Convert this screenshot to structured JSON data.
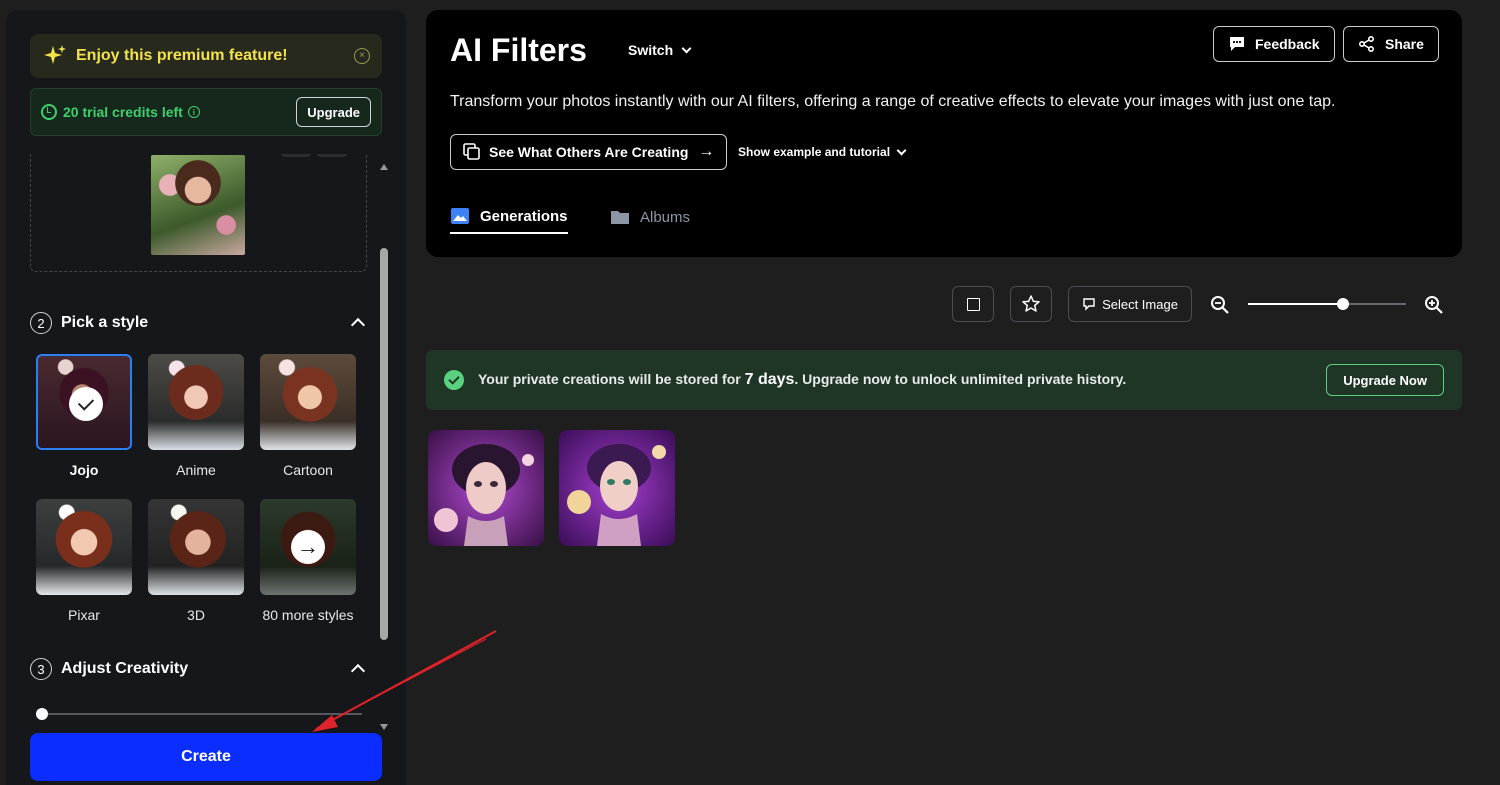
{
  "premium": {
    "text": "Enjoy this premium feature!",
    "close": "×"
  },
  "credits": {
    "text": "20 trial credits left",
    "info": "i",
    "upgrade_label": "Upgrade"
  },
  "sections": {
    "style": {
      "number": "2",
      "title": "Pick a style"
    },
    "creativity": {
      "number": "3",
      "title": "Adjust Creativity",
      "value": 0
    }
  },
  "styles": [
    {
      "label": "Jojo",
      "selected": true
    },
    {
      "label": "Anime",
      "selected": false
    },
    {
      "label": "Cartoon",
      "selected": false
    },
    {
      "label": "Pixar",
      "selected": false
    },
    {
      "label": "3D",
      "selected": false
    },
    {
      "label": "80 more styles",
      "selected": false
    }
  ],
  "create_label": "Create",
  "header": {
    "title": "AI Filters",
    "switch_label": "Switch",
    "feedback_label": "Feedback",
    "share_label": "Share",
    "description": "Transform your photos instantly with our AI filters, offering a range of creative effects to elevate your images with just one tap.",
    "see_others_label": "See What Others Are Creating",
    "tutorial_label": "Show example and tutorial",
    "tabs": [
      {
        "label": "Generations",
        "active": true
      },
      {
        "label": "Albums",
        "active": false
      }
    ]
  },
  "toolbar": {
    "select_image_label": "Select Image",
    "zoom_level": 0.6
  },
  "banner": {
    "text_before": "Your private creations will be stored for ",
    "days": "7 days",
    "text_after": ". Upgrade now to unlock unlimited private history.",
    "button_label": "Upgrade Now"
  },
  "colors": {
    "accent_blue": "#0c2dff",
    "success_green": "#5ad17f",
    "premium_yellow": "#f4e24b"
  },
  "generations_count": 2
}
